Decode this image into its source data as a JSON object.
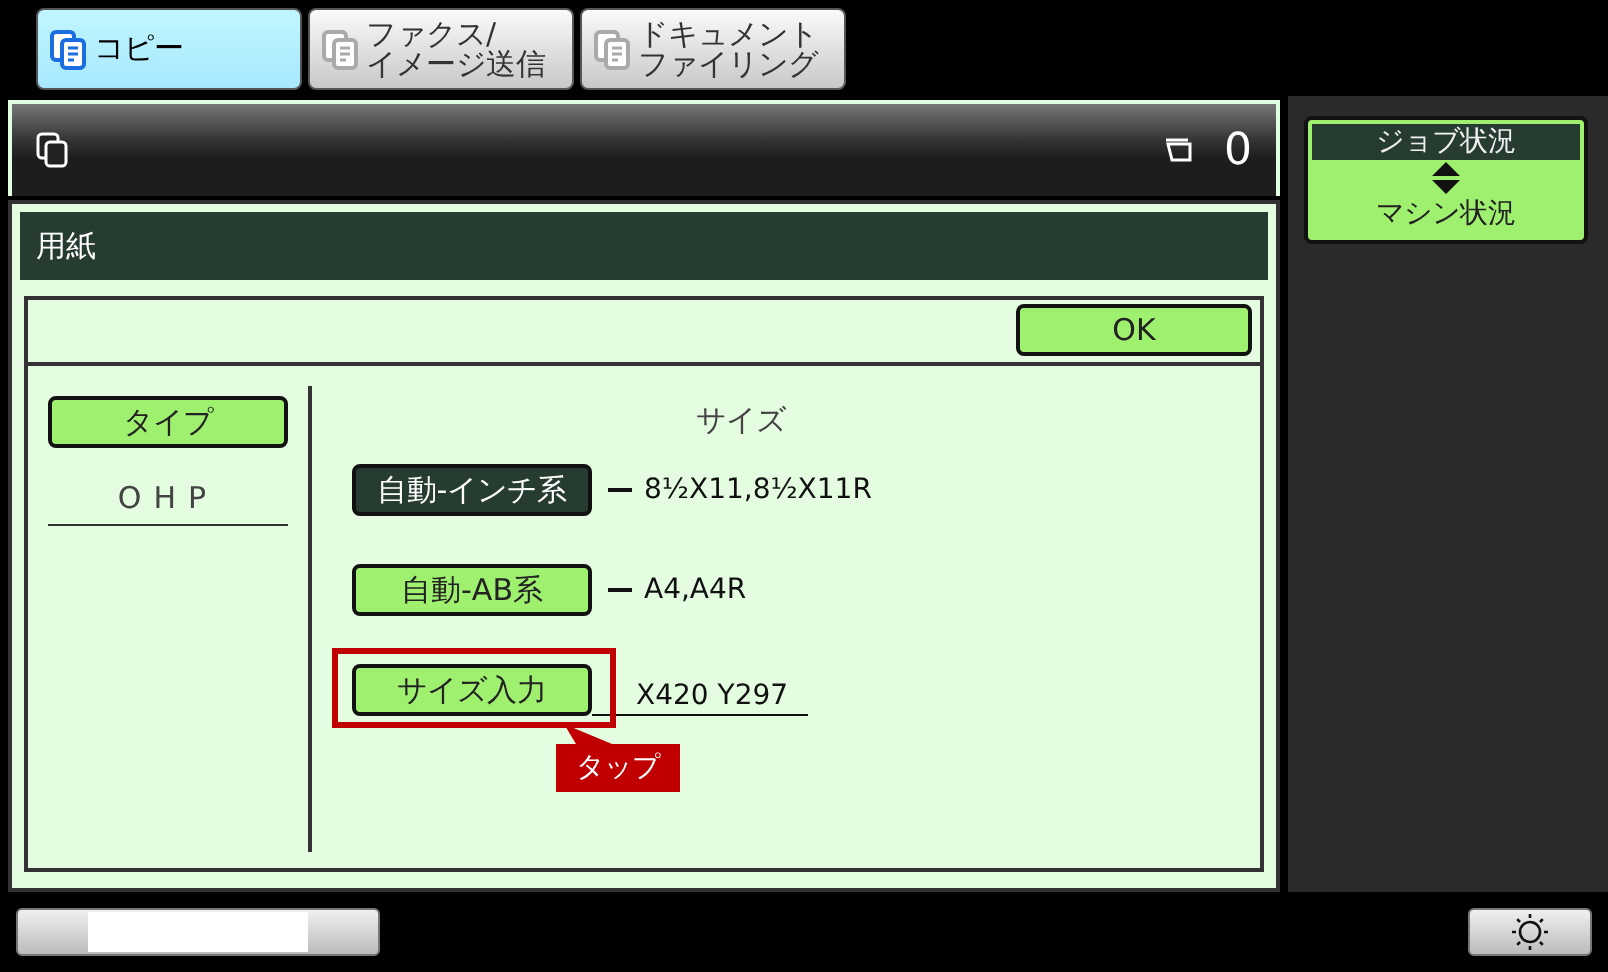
{
  "tabs": [
    {
      "lines": [
        "コピー"
      ],
      "selected": true
    },
    {
      "lines": [
        "ファクス/",
        "イメージ送信"
      ],
      "selected": false
    },
    {
      "lines": [
        "ドキュメント",
        "ファイリング"
      ],
      "selected": false
    }
  ],
  "header": {
    "job_count": "0"
  },
  "status_button": {
    "top": "ジョブ状況",
    "bottom": "マシン状況"
  },
  "dialog": {
    "title": "用紙",
    "ok": "OK",
    "type_button": "タイプ",
    "type_value": "OHP",
    "size_heading": "サイズ",
    "sizes": [
      {
        "kind": "auto",
        "label": "自動-インチ系",
        "value": "8½X11,8½X11R",
        "selected": true
      },
      {
        "kind": "auto",
        "label": "自動-AB系",
        "value": "A4,A4R",
        "selected": false
      },
      {
        "kind": "input",
        "label": "サイズ入力",
        "value": "X420 Y297",
        "selected": false
      }
    ]
  },
  "annotation": {
    "label": "タップ"
  }
}
